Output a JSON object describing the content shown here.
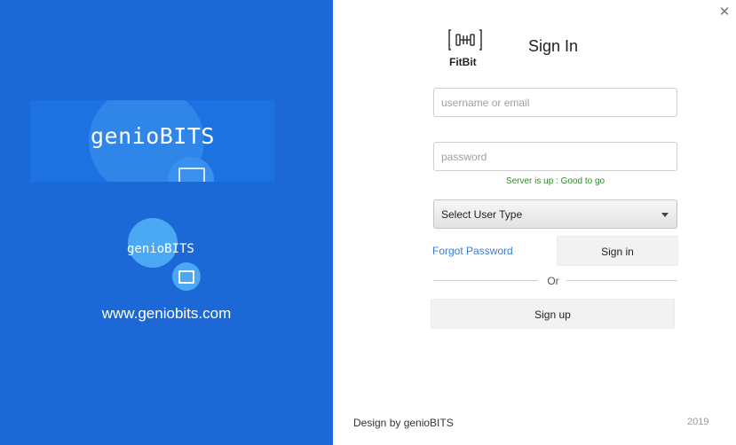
{
  "brand": {
    "banner_wordmark": "genioBITS",
    "small_wordmark": "genioBITS",
    "website": "www.geniobits.com"
  },
  "header": {
    "app_name": "FitBit",
    "title": "Sign In"
  },
  "form": {
    "username_placeholder": "username or email",
    "password_placeholder": "password",
    "status": "Server is up : Good to go",
    "user_type_selected": "Select User Type",
    "forgot_label": "Forgot Password",
    "signin_label": "Sign in",
    "divider_label": "Or",
    "signup_label": "Sign up"
  },
  "footer": {
    "credit": "Design by genioBITS",
    "year": "2019"
  },
  "icons": {
    "close": "close-icon",
    "app": "dumbbell-icon",
    "dropdown": "chevron-down-icon"
  },
  "colors": {
    "brand_blue": "#1b68d6",
    "link": "#3a7bd5",
    "status_ok": "#2a8a2a"
  }
}
